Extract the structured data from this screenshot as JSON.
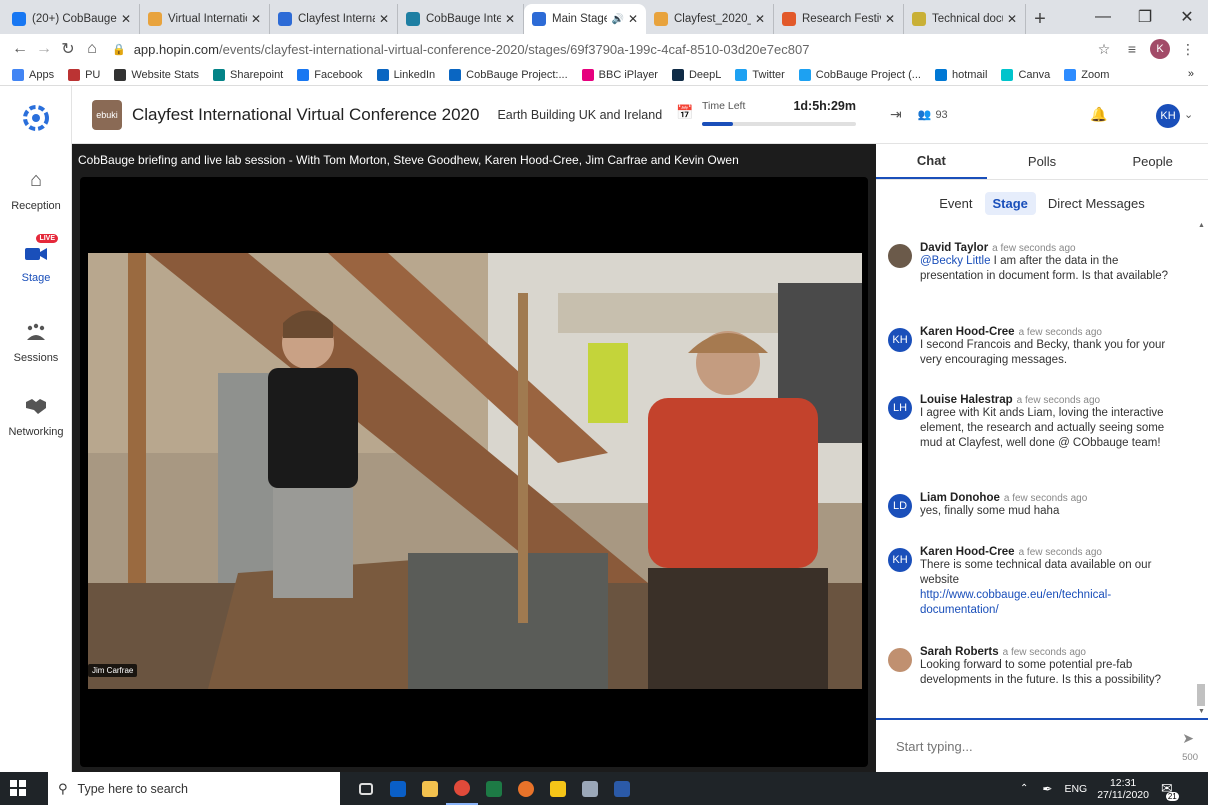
{
  "browser": {
    "tabs": [
      {
        "title": "(20+) CobBauge",
        "color": "#1877f2",
        "active": false
      },
      {
        "title": "Virtual Internatio",
        "color": "#e8a33d",
        "active": false
      },
      {
        "title": "Clayfest Internat",
        "color": "#2d6bd6",
        "active": false
      },
      {
        "title": "CobBauge Intern",
        "color": "#1e7fa3",
        "active": false
      },
      {
        "title": "Main Stage",
        "color": "#2d6bd6",
        "active": true
      },
      {
        "title": "Clayfest_2020_S",
        "color": "#e8a33d",
        "active": false
      },
      {
        "title": "Research Festiva",
        "color": "#e2592a",
        "active": false
      },
      {
        "title": "Technical docum",
        "color": "#c9b036",
        "active": false
      }
    ],
    "new_tab": "+",
    "url_domain": "app.hopin.com",
    "url_path": "/events/clayfest-international-virtual-conference-2020/stages/69f3790a-199c-4caf-8510-03d20e7ec807",
    "profile_initial": "K",
    "bookmarks": [
      {
        "label": "Apps",
        "color": "#4285f4"
      },
      {
        "label": "PU",
        "color": "#b33"
      },
      {
        "label": "Website Stats",
        "color": "#333"
      },
      {
        "label": "Sharepoint",
        "color": "#038387"
      },
      {
        "label": "Facebook",
        "color": "#1877f2"
      },
      {
        "label": "LinkedIn",
        "color": "#0a66c2"
      },
      {
        "label": "CobBauge Project:...",
        "color": "#0a66c2"
      },
      {
        "label": "BBC iPlayer",
        "color": "#e6007e"
      },
      {
        "label": "DeepL",
        "color": "#0f2b46"
      },
      {
        "label": "Twitter",
        "color": "#1da1f2"
      },
      {
        "label": "CobBauge Project (...",
        "color": "#1da1f2"
      },
      {
        "label": "hotmail",
        "color": "#0078d4"
      },
      {
        "label": "Canva",
        "color": "#00c4cc"
      },
      {
        "label": "Zoom",
        "color": "#2d8cff"
      }
    ],
    "bookmarks_more": "»"
  },
  "nav": {
    "items": [
      {
        "label": "Reception",
        "icon": "home-icon"
      },
      {
        "label": "Stage",
        "icon": "stage-live-icon",
        "badge": "LIVE"
      },
      {
        "label": "Sessions",
        "icon": "sessions-icon"
      },
      {
        "label": "Networking",
        "icon": "handshake-icon"
      }
    ]
  },
  "header": {
    "logo_text": "ebuki",
    "title": "Clayfest International Virtual Conference 2020",
    "organizer": "Earth Building UK and Ireland",
    "time_left_label": "Time Left",
    "time_left_value": "1d:5h:29m",
    "time_progress": 0.2
  },
  "stage": {
    "title": "CobBauge briefing and live lab session - With Tom Morton, Steve Goodhew, Karen Hood-Cree, Jim Carfrae and Kevin Owen",
    "speaker_name": "Jim Carfrae"
  },
  "panel": {
    "attendee_count": "93",
    "user_initials": "KH",
    "tabs": [
      "Chat",
      "Polls",
      "People"
    ],
    "subtabs": [
      "Event",
      "Stage",
      "Direct Messages"
    ],
    "messages": [
      {
        "author": "David Taylor",
        "time": "a few seconds ago",
        "initials": "",
        "mention": "@Becky Little",
        "text": " I am after the data in the presentation in document form. Is that available?"
      },
      {
        "author": "Karen Hood-Cree",
        "time": "a few seconds ago",
        "initials": "KH",
        "text": "I second Francois and Becky, thank you for your very encouraging messages."
      },
      {
        "author": "Louise Halestrap",
        "time": "a few seconds ago",
        "initials": "LH",
        "text": "I agree with Kit ands Liam, loving the interactive element, the research and actually seeing some mud at Clayfest, well done @ CObbauge team!"
      },
      {
        "author": "Liam Donohoe",
        "time": "a few seconds ago",
        "initials": "LD",
        "text": "yes, finally some mud haha"
      },
      {
        "author": "Karen Hood-Cree",
        "time": "a few seconds ago",
        "initials": "KH",
        "text": "There is some technical data available on our website",
        "link": "http://www.cobbauge.eu/en/technical-documentation/"
      },
      {
        "author": "Sarah Roberts",
        "time": "a few seconds ago",
        "initials": "",
        "text": "Looking forward to some potential pre-fab developments in the future. Is this a possibility?"
      }
    ],
    "composer_placeholder": "Start typing...",
    "char_limit": "500"
  },
  "taskbar": {
    "search_placeholder": "Type here to search",
    "language": "ENG",
    "time": "12:31",
    "date": "27/11/2020",
    "notification_count": "21"
  }
}
